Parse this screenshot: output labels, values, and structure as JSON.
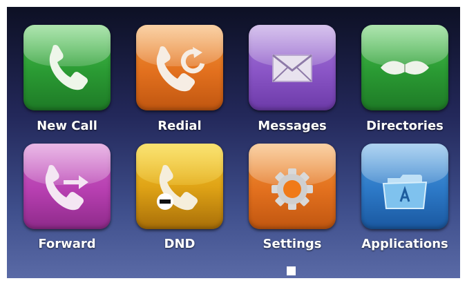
{
  "tiles": [
    {
      "label": "New Call",
      "icon": "phone-icon",
      "color": "#2e9e3a"
    },
    {
      "label": "Redial",
      "icon": "redial-icon",
      "color": "#e2701e"
    },
    {
      "label": "Messages",
      "icon": "envelope-icon",
      "color": "#8a55c6"
    },
    {
      "label": "Directories",
      "icon": "book-icon",
      "color": "#2e9e3a"
    },
    {
      "label": "Forward",
      "icon": "forward-icon",
      "color": "#b63fb0"
    },
    {
      "label": "DND",
      "icon": "dnd-icon",
      "color": "#e8a818"
    },
    {
      "label": "Settings",
      "icon": "gear-icon",
      "color": "#e2701e"
    },
    {
      "label": "Applications",
      "icon": "folder-icon",
      "color": "#2c78c6"
    }
  ],
  "pagination": {
    "current_page": 1
  }
}
